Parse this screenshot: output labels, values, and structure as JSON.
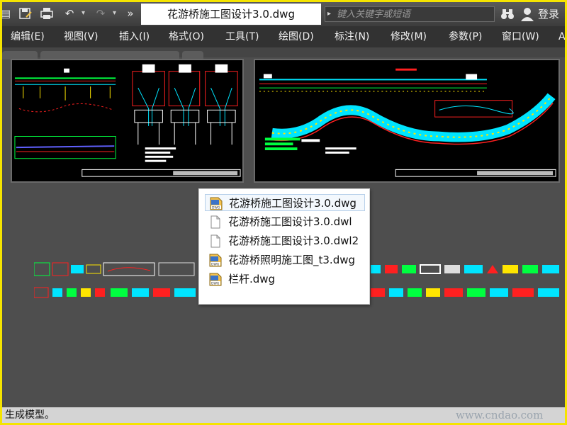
{
  "window": {
    "document_title": "花游桥施工图设计3.0.dwg",
    "search_placeholder": "键入关键字或短语",
    "login_label": "登录"
  },
  "quick_access": {
    "icons": [
      "app-menu-icon",
      "save-as-icon",
      "print-icon",
      "undo-icon",
      "redo-icon",
      "more-icon"
    ]
  },
  "menu": {
    "items": [
      {
        "label": "编辑(E)"
      },
      {
        "label": "视图(V)"
      },
      {
        "label": "插入(I)"
      },
      {
        "label": "格式(O)"
      },
      {
        "label": "工具(T)"
      },
      {
        "label": "绘图(D)"
      },
      {
        "label": "标注(N)"
      },
      {
        "label": "修改(M)"
      },
      {
        "label": "参数(P)"
      },
      {
        "label": "窗口(W)"
      },
      {
        "label": "A"
      }
    ]
  },
  "file_list": {
    "selected_index": 0,
    "items": [
      {
        "name": "花游桥施工图设计3.0.dwg",
        "icon": "dwg-file-icon"
      },
      {
        "name": "花游桥施工图设计3.0.dwl",
        "icon": "blank-file-icon"
      },
      {
        "name": "花游桥施工图设计3.0.dwl2",
        "icon": "blank-file-icon"
      },
      {
        "name": "花游桥照明施工图_t3.dwg",
        "icon": "dwg-file-icon"
      },
      {
        "name": "栏杆.dwg",
        "icon": "dwg-file-icon"
      }
    ]
  },
  "status": {
    "text": "生成模型。",
    "watermark": "www.cndao.com"
  },
  "colors": {
    "frame_border": "#f5e400",
    "canvas": "#4e4e4e",
    "menubar": "#323232",
    "cad_red": "#ff2020",
    "cad_green": "#00ff40",
    "cad_cyan": "#00e5ff",
    "cad_yellow": "#ffe600"
  }
}
